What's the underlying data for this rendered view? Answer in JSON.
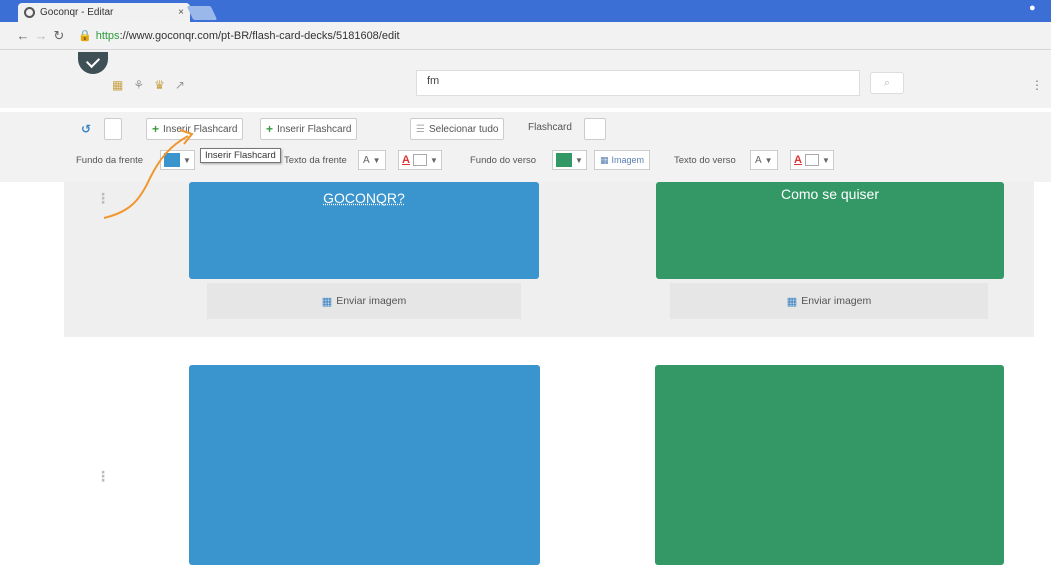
{
  "browser": {
    "tab_title": "Goconqr - Editar",
    "tab_close": "×",
    "url_prefix": "https",
    "url_rest": "://www.goconqr.com/pt-BR/flash-card-decks/5181608/edit"
  },
  "header": {
    "search_value": "fm",
    "search_button": "⌕"
  },
  "toolbar": {
    "insert_above": "Inserir Flashcard",
    "insert_below": "Inserir Flashcard",
    "select_all": "Selecionar tudo",
    "flashcard_label": "Flashcard"
  },
  "tooltip": "Inserir Flashcard",
  "format": {
    "front_bg_label": "Fundo da frente",
    "front_text_label": "Texto da frente",
    "back_bg_label": "Fundo do verso",
    "back_text_label": "Texto do verso",
    "font_size": "A",
    "image_label": "Imagem",
    "front_color": "#3a95cf",
    "back_color": "#339866"
  },
  "cards": [
    {
      "front": "GOCONQR?",
      "back": "Como se quiser",
      "front_image_btn": "Enviar imagem",
      "back_image_btn": "Enviar imagem"
    },
    {
      "front": "",
      "back": ""
    }
  ],
  "colors": {
    "front": "#3a95cf",
    "back": "#339866",
    "arrow": "#f0962e"
  }
}
